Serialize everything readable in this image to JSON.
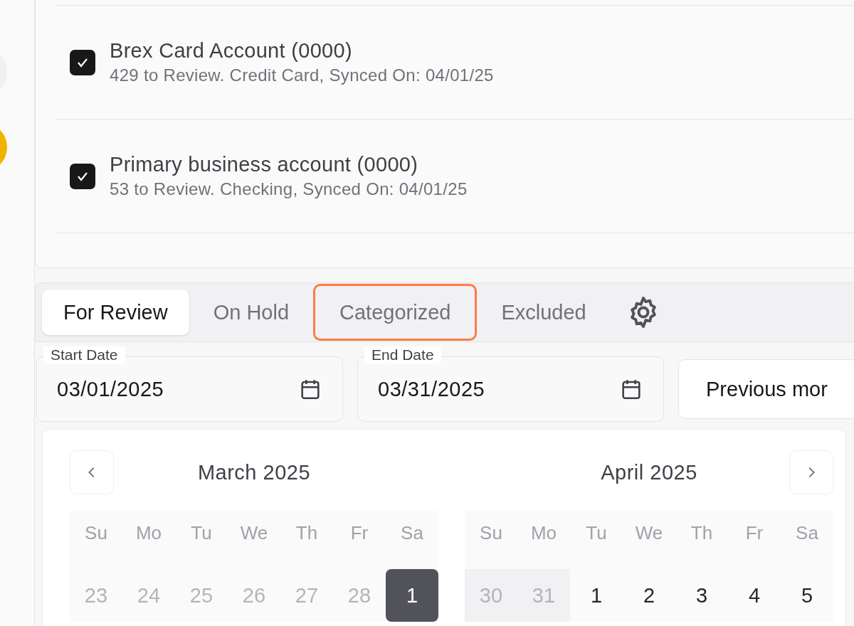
{
  "accounts": [
    {
      "name": "Brex Card Account (0000)",
      "detail": "429 to Review. Credit Card, Synced On: 04/01/25",
      "checked": true
    },
    {
      "name": "Primary business account (0000)",
      "detail": "53 to Review. Checking, Synced On: 04/01/25",
      "checked": true
    }
  ],
  "tabs": [
    {
      "label": "For Review",
      "selected": true,
      "highlighted": false
    },
    {
      "label": "On Hold",
      "selected": false,
      "highlighted": false
    },
    {
      "label": "Categorized",
      "selected": false,
      "highlighted": true
    },
    {
      "label": "Excluded",
      "selected": false,
      "highlighted": false
    }
  ],
  "date_fields": [
    {
      "label": "Start Date",
      "value": "03/01/2025"
    },
    {
      "label": "End Date",
      "value": "03/31/2025"
    }
  ],
  "preset_button": "Previous mor",
  "calendar": {
    "months": [
      {
        "title": "March 2025",
        "weekdays": [
          "Su",
          "Mo",
          "Tu",
          "We",
          "Th",
          "Fr",
          "Sa"
        ],
        "days": [
          {
            "label": "23",
            "kind": "outside",
            "selected": false
          },
          {
            "label": "24",
            "kind": "outside",
            "selected": false
          },
          {
            "label": "25",
            "kind": "outside",
            "selected": false
          },
          {
            "label": "26",
            "kind": "outside",
            "selected": false
          },
          {
            "label": "27",
            "kind": "outside",
            "selected": false
          },
          {
            "label": "28",
            "kind": "outside",
            "selected": false
          },
          {
            "label": "1",
            "kind": "current",
            "selected": true
          }
        ]
      },
      {
        "title": "April 2025",
        "weekdays": [
          "Su",
          "Mo",
          "Tu",
          "We",
          "Th",
          "Fr",
          "Sa"
        ],
        "days": [
          {
            "label": "30",
            "kind": "outside-range",
            "selected": false
          },
          {
            "label": "31",
            "kind": "outside-range",
            "selected": false
          },
          {
            "label": "1",
            "kind": "current",
            "selected": false
          },
          {
            "label": "2",
            "kind": "current",
            "selected": false
          },
          {
            "label": "3",
            "kind": "current",
            "selected": false
          },
          {
            "label": "4",
            "kind": "current",
            "selected": false
          },
          {
            "label": "5",
            "kind": "current",
            "selected": false
          }
        ]
      }
    ]
  }
}
